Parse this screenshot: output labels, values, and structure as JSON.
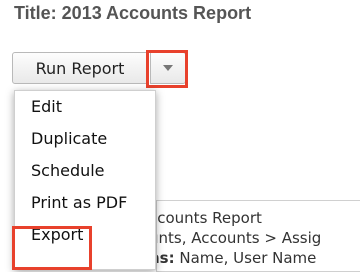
{
  "header": {
    "title": "Title: 2013 Accounts Report"
  },
  "actions": {
    "run_label": "Run Report",
    "caret_icon": "chevron-down-icon"
  },
  "menu": {
    "items": [
      "Edit",
      "Duplicate",
      "Schedule",
      "Print as PDF",
      "Export"
    ]
  },
  "report_info": {
    "line1": "ccounts Report",
    "line2": "unts, Accounts > Assig",
    "line3_label": "ns:",
    "line3_value": " Name, User Name"
  },
  "colors": {
    "highlight": "#e8412c"
  }
}
